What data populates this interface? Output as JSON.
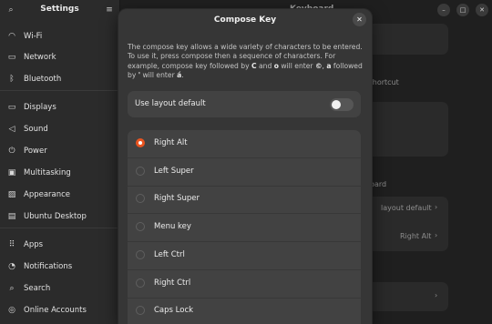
{
  "sidebar": {
    "title": "Settings",
    "items": [
      {
        "label": "Wi-Fi",
        "icon": "wifi-icon",
        "glyph": "◠"
      },
      {
        "label": "Network",
        "icon": "network-icon",
        "glyph": "▭"
      },
      {
        "label": "Bluetooth",
        "icon": "bluetooth-icon",
        "glyph": "ᛒ"
      },
      {
        "label": "Displays",
        "icon": "display-icon",
        "glyph": "▭"
      },
      {
        "label": "Sound",
        "icon": "sound-icon",
        "glyph": "◁"
      },
      {
        "label": "Power",
        "icon": "power-icon",
        "glyph": "⏻"
      },
      {
        "label": "Multitasking",
        "icon": "multitasking-icon",
        "glyph": "▣"
      },
      {
        "label": "Appearance",
        "icon": "appearance-icon",
        "glyph": "▨"
      },
      {
        "label": "Ubuntu Desktop",
        "icon": "ubuntu-desktop-icon",
        "glyph": "▤"
      },
      {
        "label": "Apps",
        "icon": "apps-icon",
        "glyph": "⠿"
      },
      {
        "label": "Notifications",
        "icon": "bell-icon",
        "glyph": "◔"
      },
      {
        "label": "Search",
        "icon": "search-icon",
        "glyph": "⌕"
      },
      {
        "label": "Online Accounts",
        "icon": "online-accounts-icon",
        "glyph": "◎"
      }
    ]
  },
  "main": {
    "title": "Keyboard",
    "bg_shortcut": "d shortcut",
    "bg_keyboard": "board",
    "bg_layout_default": "layout default",
    "bg_right_alt": "Right Alt",
    "chevron": "›"
  },
  "window": {
    "minimize": "–",
    "maximize": "□",
    "close": "✕"
  },
  "dialog": {
    "title": "Compose Key",
    "close": "✕",
    "desc_1": "The compose key allows a wide variety of characters to be entered. To use it, press compose then a sequence of characters.  For example, compose key followed by ",
    "key_c": "C",
    "desc_2": " and ",
    "key_o": "o",
    "desc_3": " will enter ",
    "res_1": "©",
    "desc_4": ", ",
    "key_a": "a",
    "desc_5": " followed by ",
    "key_apos": "'",
    "desc_6": " will enter ",
    "res_2": "á",
    "desc_7": ".",
    "toggle_label": "Use layout default",
    "toggle_on": false,
    "options": [
      {
        "label": "Right Alt",
        "selected": true
      },
      {
        "label": "Left Super",
        "selected": false
      },
      {
        "label": "Right Super",
        "selected": false
      },
      {
        "label": "Menu key",
        "selected": false
      },
      {
        "label": "Left Ctrl",
        "selected": false
      },
      {
        "label": "Right Ctrl",
        "selected": false
      },
      {
        "label": "Caps Lock",
        "selected": false
      }
    ]
  },
  "colors": {
    "accent": "#e95420",
    "dialog_bg": "#363636",
    "card_bg": "#424242"
  }
}
